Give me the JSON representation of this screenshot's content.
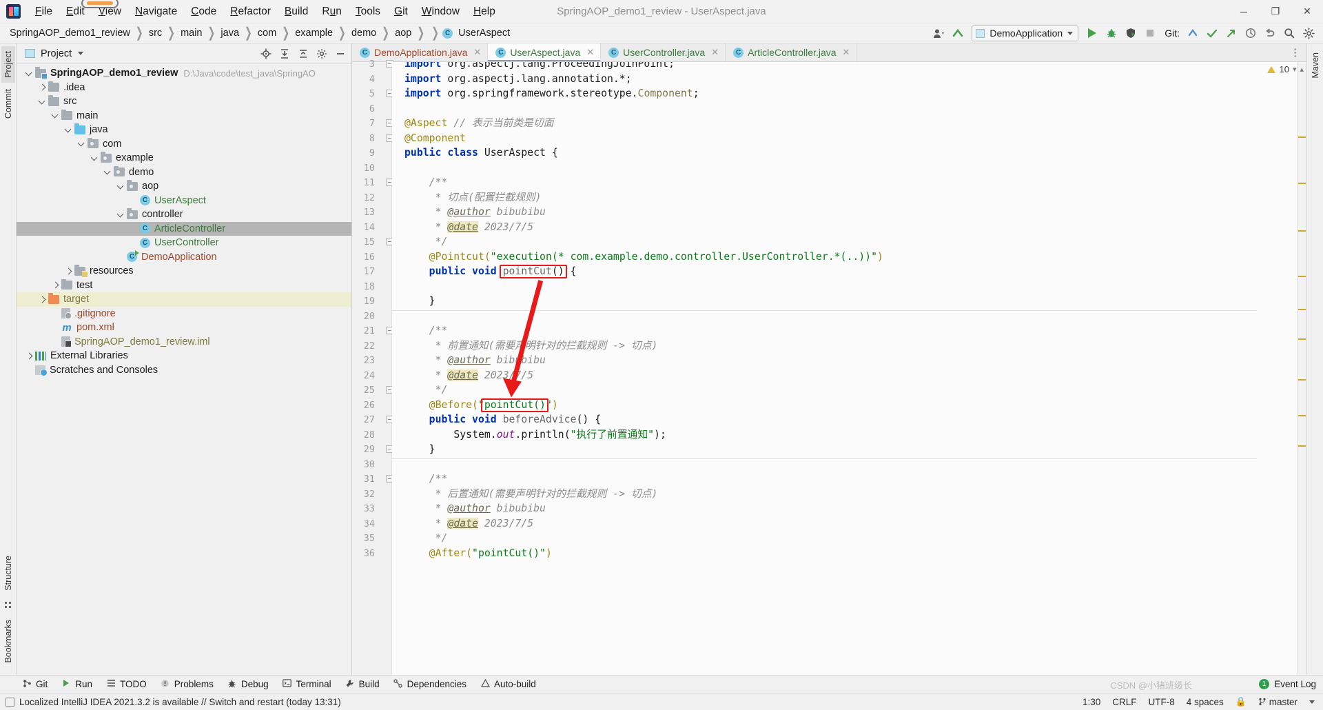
{
  "window": {
    "title": "SpringAOP_demo1_review - UserAspect.java",
    "minimize": "─",
    "maximize": "❐",
    "close": "✕"
  },
  "menu": [
    {
      "label": "File",
      "accel": "F"
    },
    {
      "label": "Edit",
      "accel": "E"
    },
    {
      "label": "View",
      "accel": "V"
    },
    {
      "label": "Navigate",
      "accel": "N"
    },
    {
      "label": "Code",
      "accel": "C"
    },
    {
      "label": "Refactor",
      "accel": "R"
    },
    {
      "label": "Build",
      "accel": "B"
    },
    {
      "label": "Run",
      "accel": "u"
    },
    {
      "label": "Tools",
      "accel": "T"
    },
    {
      "label": "Git",
      "accel": "G"
    },
    {
      "label": "Window",
      "accel": "W"
    },
    {
      "label": "Help",
      "accel": "H"
    }
  ],
  "navbar": {
    "crumbs": [
      "SpringAOP_demo1_review",
      "src",
      "main",
      "java",
      "com",
      "example",
      "demo",
      "aop"
    ],
    "current_class": "UserAspect",
    "class_icon_letter": "C",
    "run_config": "DemoApplication",
    "git_label": "Git:",
    "icons": {
      "user": "user-icon",
      "updates": "update-project-icon",
      "run": "run-icon",
      "debug": "debug-icon",
      "coverage": "run-with-coverage-icon",
      "stop": "stop-icon",
      "commit": "git-commit-icon",
      "checkmark": "git-update-icon",
      "push": "git-push-icon",
      "history": "history-icon",
      "undo": "undo-icon",
      "search": "search-everywhere-icon",
      "settings": "settings-icon",
      "maven": "maven-icon"
    }
  },
  "left_strip": [
    {
      "label": "Project",
      "selected": true
    },
    {
      "label": "Commit",
      "selected": false
    },
    {
      "label": "Structure",
      "selected": false
    },
    {
      "label": "Bookmarks",
      "selected": false
    }
  ],
  "right_strip": [
    {
      "label": "Maven",
      "selected": false
    }
  ],
  "project_panel": {
    "title": "Project",
    "actions": [
      "locate-icon",
      "expand-all-icon",
      "collapse-all-icon",
      "settings-icon",
      "hide-icon"
    ],
    "tree": [
      {
        "label": "SpringAOP_demo1_review",
        "path": "D:\\Java\\code\\test_java\\SpringAO",
        "indent": 0,
        "toggle": "down",
        "icon": "module-folder",
        "style": "bold",
        "selected": false
      },
      {
        "label": ".idea",
        "indent": 1,
        "toggle": "right",
        "icon": "folder",
        "style": "normal",
        "selected": false
      },
      {
        "label": "src",
        "indent": 1,
        "toggle": "down",
        "icon": "folder",
        "style": "normal",
        "selected": false
      },
      {
        "label": "main",
        "indent": 2,
        "toggle": "down",
        "icon": "folder",
        "style": "normal",
        "selected": false
      },
      {
        "label": "java",
        "indent": 3,
        "toggle": "down",
        "icon": "folder-blue",
        "style": "normal",
        "selected": false
      },
      {
        "label": "com",
        "indent": 4,
        "toggle": "down",
        "icon": "package",
        "style": "normal",
        "selected": false
      },
      {
        "label": "example",
        "indent": 5,
        "toggle": "down",
        "icon": "package",
        "style": "normal",
        "selected": false
      },
      {
        "label": "demo",
        "indent": 6,
        "toggle": "down",
        "icon": "package",
        "style": "normal",
        "selected": false
      },
      {
        "label": "aop",
        "indent": 7,
        "toggle": "down",
        "icon": "package",
        "style": "normal",
        "selected": false
      },
      {
        "label": "UserAspect",
        "indent": 8,
        "toggle": "none",
        "icon": "java-class",
        "style": "green",
        "selected": false
      },
      {
        "label": "controller",
        "indent": 7,
        "toggle": "down",
        "icon": "package",
        "style": "normal",
        "selected": false
      },
      {
        "label": "ArticleController",
        "indent": 8,
        "toggle": "none",
        "icon": "java-class",
        "style": "green",
        "selected": true
      },
      {
        "label": "UserController",
        "indent": 8,
        "toggle": "none",
        "icon": "java-class",
        "style": "green",
        "selected": false
      },
      {
        "label": "DemoApplication",
        "indent": 7,
        "toggle": "none",
        "icon": "spring-class",
        "style": "brown",
        "selected": false
      },
      {
        "label": "resources",
        "indent": 3,
        "toggle": "right",
        "icon": "resources-folder",
        "style": "normal",
        "selected": false
      },
      {
        "label": "test",
        "indent": 2,
        "toggle": "right",
        "icon": "folder",
        "style": "normal",
        "selected": false
      },
      {
        "label": "target",
        "indent": 1,
        "toggle": "right",
        "icon": "folder-orange",
        "style": "olive",
        "selected": false,
        "marked": true
      },
      {
        "label": ".gitignore",
        "indent": 2,
        "toggle": "none",
        "icon": "gitignore-file",
        "style": "brown",
        "selected": false
      },
      {
        "label": "pom.xml",
        "indent": 2,
        "toggle": "none",
        "icon": "maven-file",
        "style": "brown",
        "selected": false
      },
      {
        "label": "SpringAOP_demo1_review.iml",
        "indent": 2,
        "toggle": "none",
        "icon": "iml-file",
        "style": "olive",
        "selected": false
      },
      {
        "label": "External Libraries",
        "indent": 0,
        "toggle": "right",
        "icon": "libraries",
        "style": "normal",
        "selected": false
      },
      {
        "label": "Scratches and Consoles",
        "indent": 0,
        "toggle": "none",
        "icon": "scratches",
        "style": "normal",
        "selected": false
      }
    ]
  },
  "editor": {
    "tabs": [
      {
        "label": "DemoApplication.java",
        "icon": "spring-class",
        "active": false,
        "color": "brown"
      },
      {
        "label": "UserAspect.java",
        "icon": "java-class",
        "active": true,
        "color": "green"
      },
      {
        "label": "UserController.java",
        "icon": "java-class",
        "active": false,
        "color": "green"
      },
      {
        "label": "ArticleController.java",
        "icon": "java-class",
        "active": false,
        "color": "green"
      }
    ],
    "inspection_count": "10",
    "first_visible_line": 3,
    "lines": [
      {
        "n": 3,
        "clipped": true,
        "tokens": [
          {
            "t": "import ",
            "c": "kw"
          },
          {
            "t": "org.aspectj.lang.ProceedingJoinPoint;",
            "c": "plain"
          }
        ],
        "fold": true
      },
      {
        "n": 4,
        "tokens": [
          {
            "t": "import ",
            "c": "kw"
          },
          {
            "t": "org.aspectj.lang.annotation.*;",
            "c": "plain"
          }
        ]
      },
      {
        "n": 5,
        "tokens": [
          {
            "t": "import ",
            "c": "kw"
          },
          {
            "t": "org.springframework.stereotype.",
            "c": "plain"
          },
          {
            "t": "Component",
            "c": "cls-n"
          },
          {
            "t": ";",
            "c": "plain"
          }
        ],
        "fold": true
      },
      {
        "n": 6,
        "tokens": []
      },
      {
        "n": 7,
        "tokens": [
          {
            "t": "@Aspect",
            "c": "an"
          },
          {
            "t": " ",
            "c": "plain"
          },
          {
            "t": "// 表示当前类是切面",
            "c": "cmt"
          }
        ],
        "fold": true
      },
      {
        "n": 8,
        "tokens": [
          {
            "t": "@Component",
            "c": "an"
          }
        ],
        "fold": true
      },
      {
        "n": 9,
        "tokens": [
          {
            "t": "public class ",
            "c": "kw"
          },
          {
            "t": "UserAspect ",
            "c": "plain"
          },
          {
            "t": "{",
            "c": "plain"
          }
        ]
      },
      {
        "n": 10,
        "tokens": []
      },
      {
        "n": 11,
        "indent": 1,
        "tokens": [
          {
            "t": "/**",
            "c": "cmt"
          }
        ],
        "fold": true
      },
      {
        "n": 12,
        "indent": 1,
        "tokens": [
          {
            "t": " * 切点(配置拦截规则)",
            "c": "cmt"
          }
        ]
      },
      {
        "n": 13,
        "indent": 1,
        "tokens": [
          {
            "t": " * ",
            "c": "cmt"
          },
          {
            "t": "@author",
            "c": "tag"
          },
          {
            "t": " bibubibu",
            "c": "cmt"
          }
        ]
      },
      {
        "n": 14,
        "indent": 1,
        "tokens": [
          {
            "t": " * ",
            "c": "cmt"
          },
          {
            "t": "@date",
            "c": "tag tag-hl"
          },
          {
            "t": " 2023/7/5",
            "c": "cmt"
          }
        ]
      },
      {
        "n": 15,
        "indent": 1,
        "tokens": [
          {
            "t": " */",
            "c": "cmt"
          }
        ],
        "fold": true
      },
      {
        "n": 16,
        "indent": 1,
        "tokens": [
          {
            "t": "@Pointcut(",
            "c": "an"
          },
          {
            "t": "\"execution(* com.example.demo.controller.UserController.*(..))\"",
            "c": "str"
          },
          {
            "t": ")",
            "c": "an"
          }
        ]
      },
      {
        "n": 17,
        "indent": 1,
        "tokens": [
          {
            "t": "public void ",
            "c": "kw"
          },
          {
            "t": "pointCut",
            "c": "mth"
          },
          {
            "t": "() {",
            "c": "plain"
          }
        ]
      },
      {
        "n": 18,
        "tokens": []
      },
      {
        "n": 19,
        "indent": 1,
        "tokens": [
          {
            "t": "}",
            "c": "plain"
          }
        ]
      },
      {
        "n": 20,
        "tokens": []
      },
      {
        "n": 21,
        "indent": 1,
        "tokens": [
          {
            "t": "/**",
            "c": "cmt"
          }
        ],
        "fold": true
      },
      {
        "n": 22,
        "indent": 1,
        "tokens": [
          {
            "t": " * 前置通知(需要声明针对的拦截规则 -> 切点)",
            "c": "cmt"
          }
        ]
      },
      {
        "n": 23,
        "indent": 1,
        "tokens": [
          {
            "t": " * ",
            "c": "cmt"
          },
          {
            "t": "@author",
            "c": "tag"
          },
          {
            "t": " bibubibu",
            "c": "cmt"
          }
        ]
      },
      {
        "n": 24,
        "indent": 1,
        "tokens": [
          {
            "t": " * ",
            "c": "cmt"
          },
          {
            "t": "@date",
            "c": "tag tag-hl"
          },
          {
            "t": " 2023/7/5",
            "c": "cmt"
          }
        ]
      },
      {
        "n": 25,
        "indent": 1,
        "tokens": [
          {
            "t": " */",
            "c": "cmt"
          }
        ],
        "fold": true
      },
      {
        "n": 26,
        "indent": 1,
        "tokens": [
          {
            "t": "@Before(",
            "c": "an"
          },
          {
            "t": "\"",
            "c": "str"
          },
          {
            "t": "pointCut()",
            "c": "str"
          },
          {
            "t": "\"",
            "c": "str"
          },
          {
            "t": ")",
            "c": "an"
          }
        ]
      },
      {
        "n": 27,
        "indent": 1,
        "tokens": [
          {
            "t": "public void ",
            "c": "kw"
          },
          {
            "t": "beforeAdvice",
            "c": "mth"
          },
          {
            "t": "() {",
            "c": "plain"
          }
        ],
        "fold": true
      },
      {
        "n": 28,
        "indent": 2,
        "tokens": [
          {
            "t": "System.",
            "c": "plain"
          },
          {
            "t": "out",
            "c": "fld"
          },
          {
            "t": ".println(",
            "c": "plain"
          },
          {
            "t": "\"执行了前置通知\"",
            "c": "str"
          },
          {
            "t": ");",
            "c": "plain"
          }
        ]
      },
      {
        "n": 29,
        "indent": 1,
        "tokens": [
          {
            "t": "}",
            "c": "plain"
          }
        ],
        "fold": true
      },
      {
        "n": 30,
        "tokens": []
      },
      {
        "n": 31,
        "indent": 1,
        "tokens": [
          {
            "t": "/**",
            "c": "cmt"
          }
        ],
        "fold": true
      },
      {
        "n": 32,
        "indent": 1,
        "tokens": [
          {
            "t": " * 后置通知(需要声明针对的拦截规则 -> 切点)",
            "c": "cmt"
          }
        ]
      },
      {
        "n": 33,
        "indent": 1,
        "tokens": [
          {
            "t": " * ",
            "c": "cmt"
          },
          {
            "t": "@author",
            "c": "tag"
          },
          {
            "t": " bibubibu",
            "c": "cmt"
          }
        ]
      },
      {
        "n": 34,
        "indent": 1,
        "tokens": [
          {
            "t": " * ",
            "c": "cmt"
          },
          {
            "t": "@date",
            "c": "tag tag-hl"
          },
          {
            "t": " 2023/7/5",
            "c": "cmt"
          }
        ]
      },
      {
        "n": 35,
        "indent": 1,
        "tokens": [
          {
            "t": " */",
            "c": "cmt"
          }
        ]
      },
      {
        "n": 36,
        "indent": 1,
        "clipped_bottom": true,
        "tokens": [
          {
            "t": "@After(",
            "c": "an"
          },
          {
            "t": "\"pointCut()\"",
            "c": "str"
          },
          {
            "t": ")",
            "c": "an"
          }
        ]
      }
    ],
    "annotations": {
      "box1_label": "pointCut() declaration highlight",
      "box2_label": "pointCut() reference highlight",
      "arrow_color": "#e81919"
    }
  },
  "tool_windows": {
    "left": [
      {
        "label": "Git",
        "icon": "git-icon"
      },
      {
        "label": "Run",
        "icon": "run-icon"
      },
      {
        "label": "TODO",
        "icon": "todo-icon"
      },
      {
        "label": "Problems",
        "icon": "problems-icon"
      },
      {
        "label": "Debug",
        "icon": "debug-icon"
      },
      {
        "label": "Terminal",
        "icon": "terminal-icon"
      },
      {
        "label": "Build",
        "icon": "build-icon"
      },
      {
        "label": "Dependencies",
        "icon": "dependencies-icon"
      },
      {
        "label": "Auto-build",
        "icon": "auto-build-icon"
      }
    ],
    "right": {
      "count": "1",
      "label": "Event Log"
    }
  },
  "statusbar": {
    "message": "Localized IntelliJ IDEA 2021.3.2 is available // Switch and restart (today 13:31)",
    "caret": "1:30",
    "line_sep": "CRLF",
    "encoding": "UTF-8",
    "indent": "4 spaces",
    "branch": "master",
    "lock_icon": "🔒",
    "branch_icon": "git-branch-icon"
  },
  "watermark": "CSDN @小猪班级长"
}
